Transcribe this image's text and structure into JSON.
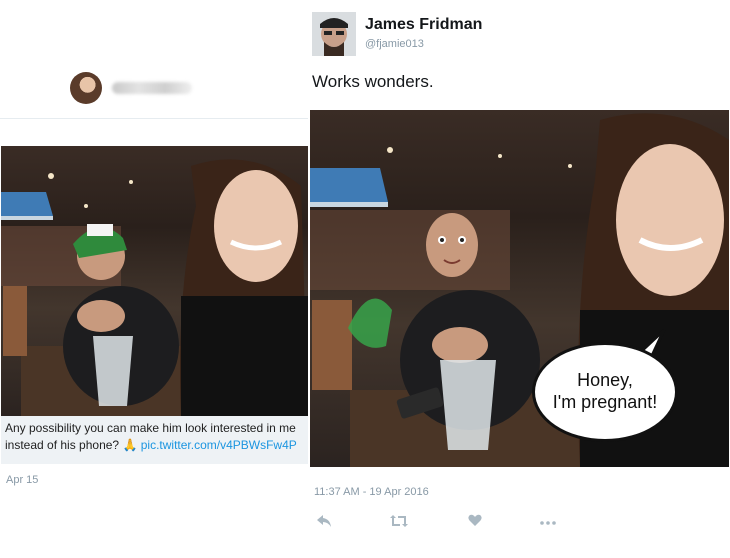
{
  "left_tweet": {
    "caption_text": "Any possibility you can make him look interested in me instead of his phone?",
    "emoji": "🙏",
    "link": "pic.twitter.com/v4PBWsFw4P",
    "date": "Apr 15"
  },
  "right_tweet": {
    "author_name": "James Fridman",
    "author_handle": "@fjamie013",
    "text": "Works wonders.",
    "bubble_line1": "Honey,",
    "bubble_line2": "I'm pregnant!",
    "timestamp": "11:37 AM - 19 Apr 2016",
    "actions": {
      "reply_icon": "reply-icon",
      "retweet_icon": "retweet-icon",
      "like_icon": "heart-icon",
      "more_icon": "more-icon"
    }
  },
  "colors": {
    "link": "#1b95e0",
    "muted": "#8899a6",
    "action_icon": "#aab8c2",
    "caption_bg": "#eef2f5"
  }
}
